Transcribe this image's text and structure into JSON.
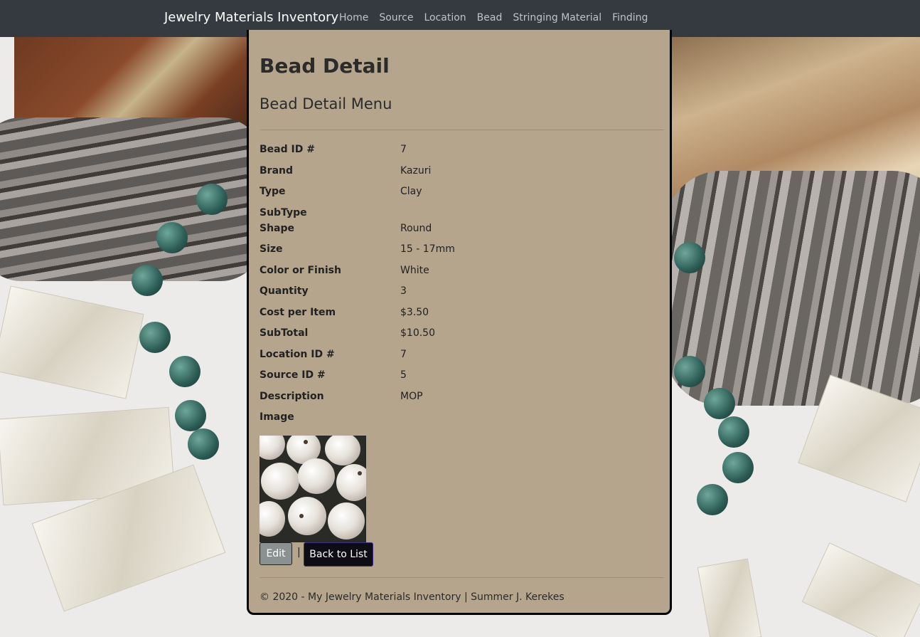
{
  "navbar": {
    "brand": "Jewelry Materials Inventory",
    "links": [
      "Home",
      "Source",
      "Location",
      "Bead",
      "Stringing Material",
      "Finding"
    ]
  },
  "page": {
    "title": "Bead Detail",
    "subtitle": "Bead Detail Menu"
  },
  "details": [
    {
      "label": "Bead ID #",
      "value": "7"
    },
    {
      "label": "Brand",
      "value": "Kazuri"
    },
    {
      "label": "Type",
      "value": "Clay"
    },
    {
      "label": "SubType",
      "value": ""
    },
    {
      "label": "Shape",
      "value": "Round"
    },
    {
      "label": "Size",
      "value": "15 - 17mm"
    },
    {
      "label": "Color or Finish",
      "value": "White"
    },
    {
      "label": "Quantity",
      "value": "3"
    },
    {
      "label": "Cost per Item",
      "value": "$3.50"
    },
    {
      "label": "SubTotal",
      "value": "$10.50"
    },
    {
      "label": "Location ID #",
      "value": "7"
    },
    {
      "label": "Source ID #",
      "value": "5"
    },
    {
      "label": "Description",
      "value": "MOP"
    },
    {
      "label": "Image",
      "value": ""
    }
  ],
  "actions": {
    "edit": "Edit",
    "separator": "|",
    "back": "Back to List"
  },
  "footer": "© 2020 - My Jewelry Materials Inventory | Summer J. Kerekes",
  "colors": {
    "navbar": "#343a40",
    "panel": "#b4a58c",
    "edit_button": "#8a9190",
    "back_button": "#0e0c14"
  }
}
